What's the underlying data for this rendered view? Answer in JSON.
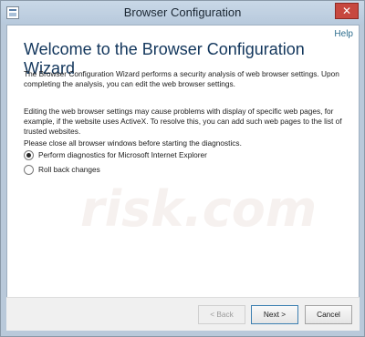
{
  "window": {
    "title": "Browser Configuration",
    "close_label": "✕"
  },
  "content": {
    "help_label": "Help",
    "heading": "Welcome to the Browser Configuration Wizard",
    "paragraph1": "The Browser Configuration Wizard performs a security analysis of web browser settings. Upon completing the analysis, you can edit the web browser settings.",
    "paragraph2": "Editing the web browser settings may cause problems with display of specific web pages, for example, if the website uses ActiveX. To resolve this, you can add such web pages to the list of trusted websites.",
    "paragraph3": "Please close all browser windows before starting the diagnostics."
  },
  "options": {
    "diagnostics_label": "Perform diagnostics for Microsoft Internet Explorer",
    "rollback_label": "Roll back changes",
    "selected": "diagnostics"
  },
  "watermark": {
    "text": "risk.com"
  },
  "footer": {
    "back_label": "< Back",
    "next_label": "Next >",
    "cancel_label": "Cancel"
  }
}
